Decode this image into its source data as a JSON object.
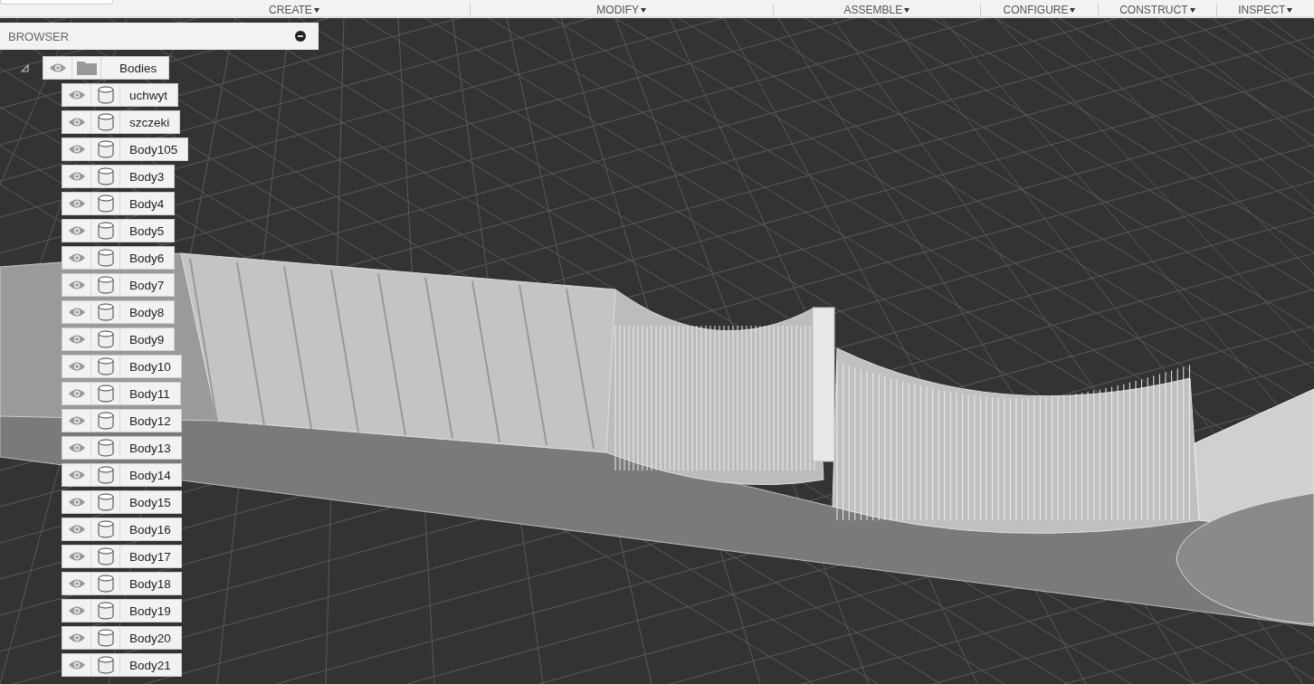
{
  "toolbar": {
    "menus": [
      {
        "label": "CREATE"
      },
      {
        "label": "MODIFY"
      },
      {
        "label": "ASSEMBLE"
      },
      {
        "label": "CONFIGURE"
      },
      {
        "label": "CONSTRUCT"
      },
      {
        "label": "INSPECT"
      }
    ]
  },
  "browser": {
    "title": "BROWSER",
    "tree": {
      "label": "Bodies",
      "expanded": true,
      "children": [
        {
          "label": "uchwyt"
        },
        {
          "label": "szczeki"
        },
        {
          "label": "Body105"
        },
        {
          "label": "Body3"
        },
        {
          "label": "Body4"
        },
        {
          "label": "Body5"
        },
        {
          "label": "Body6"
        },
        {
          "label": "Body7"
        },
        {
          "label": "Body8"
        },
        {
          "label": "Body9"
        },
        {
          "label": "Body10"
        },
        {
          "label": "Body11"
        },
        {
          "label": "Body12"
        },
        {
          "label": "Body13"
        },
        {
          "label": "Body14"
        },
        {
          "label": "Body15"
        },
        {
          "label": "Body16"
        },
        {
          "label": "Body17"
        },
        {
          "label": "Body18"
        },
        {
          "label": "Body19"
        },
        {
          "label": "Body20"
        },
        {
          "label": "Body21"
        }
      ]
    }
  }
}
